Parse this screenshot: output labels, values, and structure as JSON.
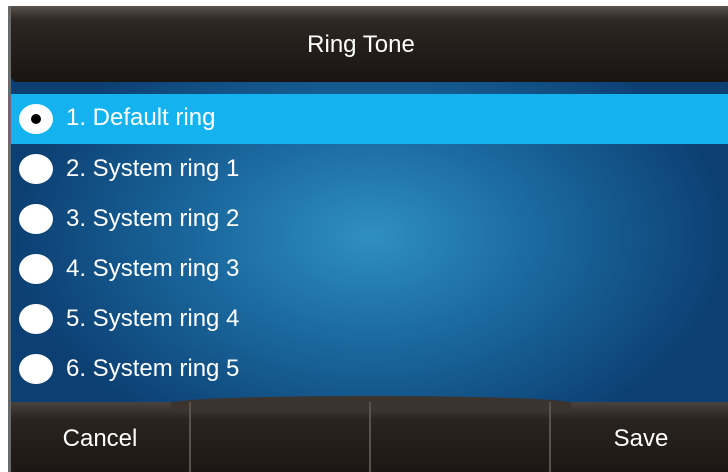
{
  "header": {
    "title": "Ring Tone"
  },
  "ringtones": [
    {
      "label": "1. Default ring",
      "selected": true
    },
    {
      "label": "2. System ring 1",
      "selected": false
    },
    {
      "label": "3. System ring 2",
      "selected": false
    },
    {
      "label": "4. System ring 3",
      "selected": false
    },
    {
      "label": "5. System ring 4",
      "selected": false
    },
    {
      "label": "6. System ring 5",
      "selected": false
    }
  ],
  "softkeys": [
    {
      "label": "Cancel"
    },
    {
      "label": ""
    },
    {
      "label": ""
    },
    {
      "label": "Save"
    }
  ],
  "colors": {
    "selection_highlight": "#14b2ee",
    "background": "#1b6aa0",
    "bar": "#221d1a"
  }
}
